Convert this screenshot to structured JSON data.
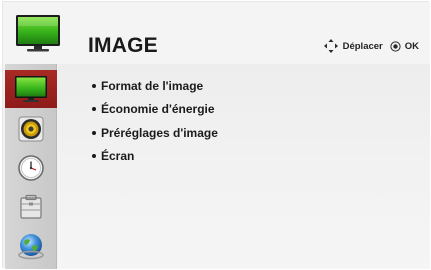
{
  "header": {
    "title": "IMAGE",
    "icon": "tv-picture-icon",
    "hint_move": "Déplacer",
    "hint_ok": "OK"
  },
  "sidebar": {
    "items": [
      {
        "icon": "tv-picture-icon",
        "active": true
      },
      {
        "icon": "speaker-audio-icon",
        "active": false
      },
      {
        "icon": "clock-time-icon",
        "active": false
      },
      {
        "icon": "toolbox-options-icon",
        "active": false
      },
      {
        "icon": "globe-network-icon",
        "active": false
      }
    ]
  },
  "menu": {
    "items": [
      {
        "label": "Format de l'image"
      },
      {
        "label": "Économie d'énergie"
      },
      {
        "label": "Préréglages d'image"
      },
      {
        "label": "Écran"
      }
    ]
  },
  "colors": {
    "active_tab": "#a82a25",
    "screen_green": "#3fae1f",
    "background": "#f2f2f2"
  }
}
